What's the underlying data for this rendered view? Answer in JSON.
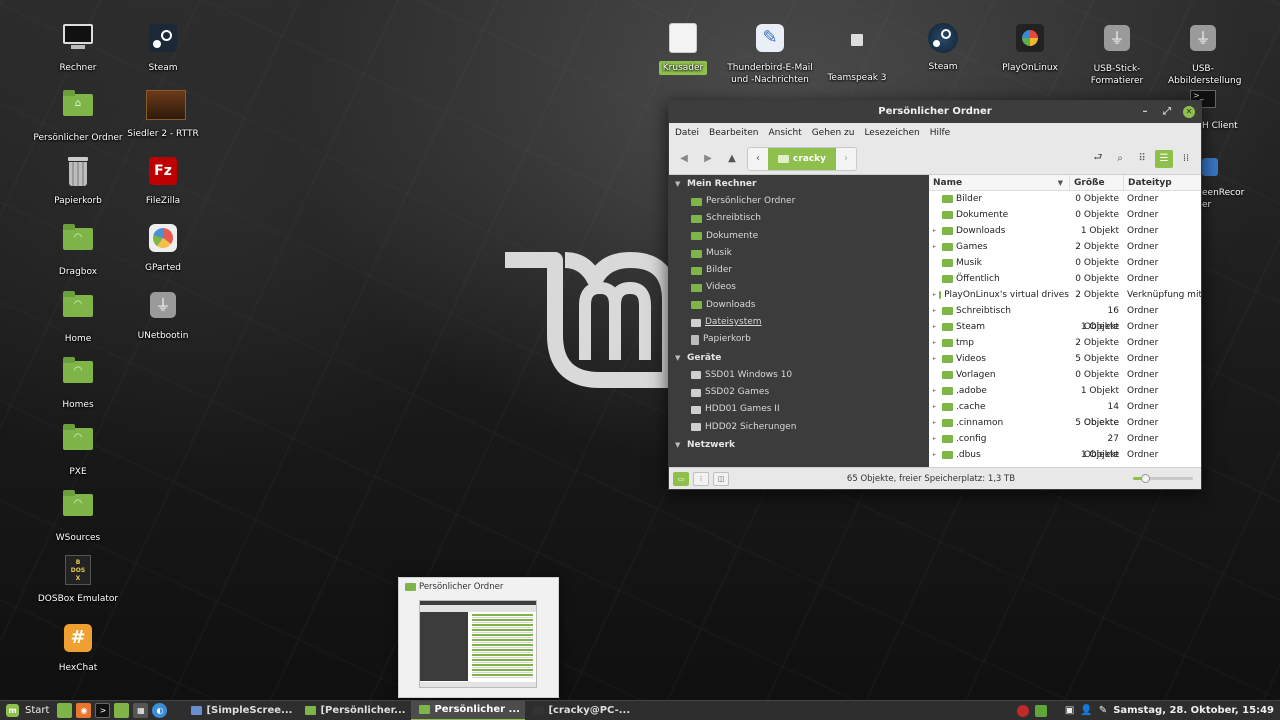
{
  "desktop": {
    "left_icons": [
      {
        "label": "Rechner",
        "icon": "computer-icon"
      },
      {
        "label": "Persönlicher Ordner",
        "icon": "home-folder-icon"
      },
      {
        "label": "Papierkorb",
        "icon": "trash-icon"
      },
      {
        "label": "Dragbox",
        "icon": "network-folder-icon"
      },
      {
        "label": "Home",
        "icon": "network-folder-icon"
      },
      {
        "label": "Homes",
        "icon": "network-folder-icon"
      },
      {
        "label": "PXE",
        "icon": "network-folder-icon"
      },
      {
        "label": "WSources",
        "icon": "network-folder-icon"
      },
      {
        "label": "DOSBox Emulator",
        "icon": "dosbox-icon"
      },
      {
        "label": "HexChat",
        "icon": "hexchat-icon"
      }
    ],
    "second_column": [
      {
        "label": "Steam",
        "icon": "steam-icon"
      },
      {
        "label": "Siedler 2 - RTTR",
        "icon": "siedler-icon"
      },
      {
        "label": "FileZilla",
        "icon": "filezilla-icon"
      },
      {
        "label": "GParted",
        "icon": "gparted-icon"
      },
      {
        "label": "UNetbootin",
        "icon": "usb-icon"
      }
    ],
    "top_icons": [
      {
        "label": "Krusader",
        "icon": "krusader-icon"
      },
      {
        "label": "Thunderbird-E-Mail und -Nachrichten",
        "icon": "thunderbird-icon"
      },
      {
        "label": "Teamspeak 3",
        "icon": "teamspeak-icon"
      },
      {
        "label": "Steam",
        "icon": "steam-icon"
      },
      {
        "label": "PlayOnLinux",
        "icon": "playonlinux-icon"
      },
      {
        "label": "USB-Stick-Formatierer",
        "icon": "usb-icon"
      },
      {
        "label": "USB-Abbilderstellung",
        "icon": "usb-icon"
      }
    ],
    "peek_labels": [
      "H Client",
      "eenRecor",
      "er"
    ]
  },
  "file_manager": {
    "title": "Persönlicher Ordner",
    "menu": [
      "Datei",
      "Bearbeiten",
      "Ansicht",
      "Gehen zu",
      "Lesezeichen",
      "Hilfe"
    ],
    "breadcrumb": "cracky",
    "sidebar": [
      {
        "heading": "Mein Rechner",
        "items": [
          {
            "label": "Persönlicher Ordner",
            "kind": "folder"
          },
          {
            "label": "Schreibtisch",
            "kind": "folder"
          },
          {
            "label": "Dokumente",
            "kind": "folder"
          },
          {
            "label": "Musik",
            "kind": "folder"
          },
          {
            "label": "Bilder",
            "kind": "folder"
          },
          {
            "label": "Videos",
            "kind": "folder"
          },
          {
            "label": "Downloads",
            "kind": "folder"
          },
          {
            "label": "Dateisystem",
            "kind": "drive"
          },
          {
            "label": "Papierkorb",
            "kind": "trash"
          }
        ]
      },
      {
        "heading": "Geräte",
        "items": [
          {
            "label": "SSD01 Windows 10",
            "kind": "drive"
          },
          {
            "label": "SSD02 Games",
            "kind": "drive"
          },
          {
            "label": "HDD01 Games II",
            "kind": "drive"
          },
          {
            "label": "HDD02 Sicherungen",
            "kind": "drive"
          }
        ]
      },
      {
        "heading": "Netzwerk",
        "items": []
      }
    ],
    "columns": {
      "name": "Name",
      "size": "Größe",
      "type": "Dateityp"
    },
    "rows": [
      {
        "name": "Bilder",
        "size": "0 Objekte",
        "type": "Ordner",
        "expand": false
      },
      {
        "name": "Dokumente",
        "size": "0 Objekte",
        "type": "Ordner",
        "expand": false
      },
      {
        "name": "Downloads",
        "size": "1 Objekt",
        "type": "Ordner",
        "expand": true
      },
      {
        "name": "Games",
        "size": "2 Objekte",
        "type": "Ordner",
        "expand": true
      },
      {
        "name": "Musik",
        "size": "0 Objekte",
        "type": "Ordner",
        "expand": false
      },
      {
        "name": "Öffentlich",
        "size": "0 Objekte",
        "type": "Ordner",
        "expand": false
      },
      {
        "name": "PlayOnLinux's virtual drives",
        "size": "2 Objekte",
        "type": "Verknüpfung mit O",
        "expand": true
      },
      {
        "name": "Schreibtisch",
        "size": "16 Objekte",
        "type": "Ordner",
        "expand": true
      },
      {
        "name": "Steam",
        "size": "1 Objekt",
        "type": "Ordner",
        "expand": true
      },
      {
        "name": "tmp",
        "size": "2 Objekte",
        "type": "Ordner",
        "expand": true
      },
      {
        "name": "Videos",
        "size": "5 Objekte",
        "type": "Ordner",
        "expand": true
      },
      {
        "name": "Vorlagen",
        "size": "0 Objekte",
        "type": "Ordner",
        "expand": false
      },
      {
        "name": ".adobe",
        "size": "1 Objekt",
        "type": "Ordner",
        "expand": true
      },
      {
        "name": ".cache",
        "size": "14 Objekte",
        "type": "Ordner",
        "expand": true
      },
      {
        "name": ".cinnamon",
        "size": "5 Objekte",
        "type": "Ordner",
        "expand": true
      },
      {
        "name": ".config",
        "size": "27 Objekte",
        "type": "Ordner",
        "expand": true
      },
      {
        "name": ".dbus",
        "size": "1 Objekt",
        "type": "Ordner",
        "expand": true
      }
    ],
    "status": "65 Objekte, freier Speicherplatz: 1,3 TB",
    "zoom_level": 0.2
  },
  "preview": {
    "title": "Persönlicher Ordner"
  },
  "taskbar": {
    "start_label": "Start",
    "tasks": [
      {
        "label": "[SimpleScree...",
        "active": false,
        "color": "#6a8fd0"
      },
      {
        "label": "[Persönlicher...",
        "active": false,
        "color": "#7fb548"
      },
      {
        "label": "Persönlicher ...",
        "active": true,
        "color": "#7fb548"
      },
      {
        "label": "[cracky@PC-...",
        "active": false,
        "color": "#333333"
      }
    ],
    "clock": "Samstag, 28. Oktober, 15:49"
  },
  "colors": {
    "accent": "#8fbf4d",
    "sidebar": "#3c3c3c",
    "titlebar": "#3d3d3d"
  }
}
